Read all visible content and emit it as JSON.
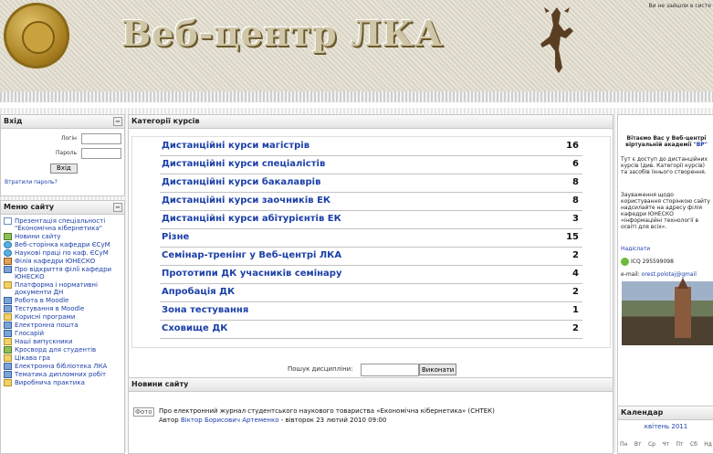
{
  "header": {
    "site_title": "Веб-центр ЛКА",
    "login_status": "Ви не зайшли в систе"
  },
  "login": {
    "title": "Вхід",
    "login_label": "Логін",
    "password_label": "Пароль",
    "submit_label": "Вхід",
    "forgot_link": "Втратили пароль?"
  },
  "menu": {
    "title": "Меню сайту",
    "items": [
      {
        "label": "Презентація спеціальності \"Економічна кібернетика\"",
        "icon": "document-icon"
      },
      {
        "label": "Новини сайту",
        "icon": "person-icon"
      },
      {
        "label": "Веб-сторінка кафедри ЄСуМ",
        "icon": "web-icon"
      },
      {
        "label": "Наукові праці по каф. ЄСуМ",
        "icon": "web-icon"
      },
      {
        "label": "Філія кафедри ЮНЕСКО",
        "icon": "face-icon"
      },
      {
        "label": "Про відкриття філії кафедри ЮНЕСКО",
        "icon": "book-icon"
      },
      {
        "label": "Платформа і нормативні документи ДН",
        "icon": "folder-icon"
      },
      {
        "label": "Робота в Moodle",
        "icon": "book-icon"
      },
      {
        "label": "Тестування в Moodle",
        "icon": "book-icon"
      },
      {
        "label": "Корисні програми",
        "icon": "folder-icon"
      },
      {
        "label": "Електронна пошта",
        "icon": "book-icon"
      },
      {
        "label": "Глосарій",
        "icon": "book-icon"
      },
      {
        "label": "Наші випускники",
        "icon": "folder-icon"
      },
      {
        "label": "Кросворд для студентів",
        "icon": "person-icon"
      },
      {
        "label": "Цікава гра",
        "icon": "folder-icon"
      },
      {
        "label": "Електронна бібліотека ЛКА",
        "icon": "book-icon"
      },
      {
        "label": "Тематика дипломних робіт",
        "icon": "book-icon"
      },
      {
        "label": "Виробнича практика",
        "icon": "folder-icon"
      }
    ]
  },
  "categories": {
    "title": "Категорії курсів",
    "items": [
      {
        "name": "Дистанційні курси магістрів",
        "count": "16"
      },
      {
        "name": "Дистанційні курси спеціалістів",
        "count": "6"
      },
      {
        "name": "Дистанційні курси бакалаврів",
        "count": "8"
      },
      {
        "name": "Дистанційні курси заочників ЕК",
        "count": "8"
      },
      {
        "name": "Дистанційні курси абітурієнтів ЕК",
        "count": "3"
      },
      {
        "name": "Різне",
        "count": "15"
      },
      {
        "name": "Семінар-тренінг у Веб-центрі ЛКА",
        "count": "2"
      },
      {
        "name": "Прототипи ДК учасників семінару",
        "count": "4"
      },
      {
        "name": "Апробація ДК",
        "count": "2"
      },
      {
        "name": "Зона тестування",
        "count": "1"
      },
      {
        "name": "Сховище ДК",
        "count": "2"
      }
    ],
    "search_label": "Пошук дисципліни:",
    "search_button": "Виконати"
  },
  "news": {
    "title": "Новини сайту",
    "tag": "Фото",
    "headline": "Про електронний журнал студентського наукового товариства «Економічна кібернетика» (СНТЕК)",
    "author_prefix": "Автор",
    "author_name": "Віктор Борисович Артеменко",
    "date": "- вівторок 23 лютий 2010 09:00"
  },
  "right": {
    "welcome_1": "Вітаємо Вас у Веб-центрі",
    "welcome_2": "віртуальній академії",
    "welcome_link": "\"ВР\"",
    "p1": "Тут є доступ до дистанційних курсів (див. Категорії курсів) та засобів їхнього створення.",
    "p2": "Зауваження щодо користування сторінкою сайту надсилайте на адресу філія кафедри ЮНЕСКО «інформаційні технології в освіті для всіх».",
    "contact_link": "Надіслати",
    "icq": "ICQ 295599098",
    "email_label": "e-mail:",
    "email": "orest.polotaj@gmail"
  },
  "calendar": {
    "title": "Календар",
    "month": "квітень 2011",
    "days": [
      "Пн",
      "Вт",
      "Ср",
      "Чт",
      "Пт",
      "Сб",
      "Нд"
    ]
  },
  "colors": {
    "link": "#1b3fa8",
    "header_bg": "#e2ddcf",
    "title_gold": "#cfc6a8"
  }
}
